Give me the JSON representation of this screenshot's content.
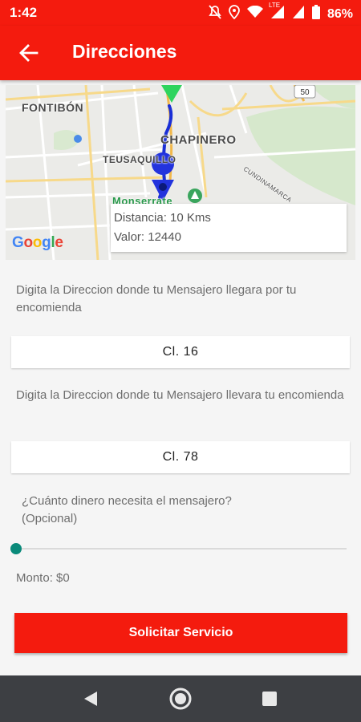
{
  "status_bar": {
    "time": "1:42",
    "battery": "86%",
    "network_label": "LTE"
  },
  "app_bar": {
    "title": "Direcciones"
  },
  "map": {
    "labels": {
      "fontibon": "FONTIBÓN",
      "chapinero": "CHAPINERO",
      "teusaquillo": "TEUSAQUILLO",
      "cundinamarca": "CUNDINAMARCA",
      "road_number": "50",
      "partial": "Monserrate"
    },
    "info": {
      "distance": "Distancia: 10 Kms",
      "value": "Valor: 12440"
    },
    "attribution": "Google"
  },
  "form": {
    "pickup_label": "Digita la Direccion donde tu Mensajero llegara por tu encomienda",
    "pickup_value": "Cl. 16",
    "dropoff_label": "Digita la Direccion donde tu Mensajero llevara tu encomienda",
    "dropoff_value": "Cl. 78",
    "money_label": "¿Cuánto dinero necesita el mensajero? (Opcional)",
    "slider_value_fraction": 0,
    "amount": "Monto: $0",
    "submit": "Solicitar Servicio"
  },
  "colors": {
    "primary": "#f41b0e",
    "slider_accent": "#0a8a7a",
    "route": "#1a2fd6"
  },
  "icons": [
    "back-arrow-icon",
    "mute-icon",
    "location-icon",
    "wifi-icon",
    "signal-icon",
    "battery-icon",
    "nav-back-icon",
    "nav-home-icon",
    "nav-recents-icon"
  ]
}
